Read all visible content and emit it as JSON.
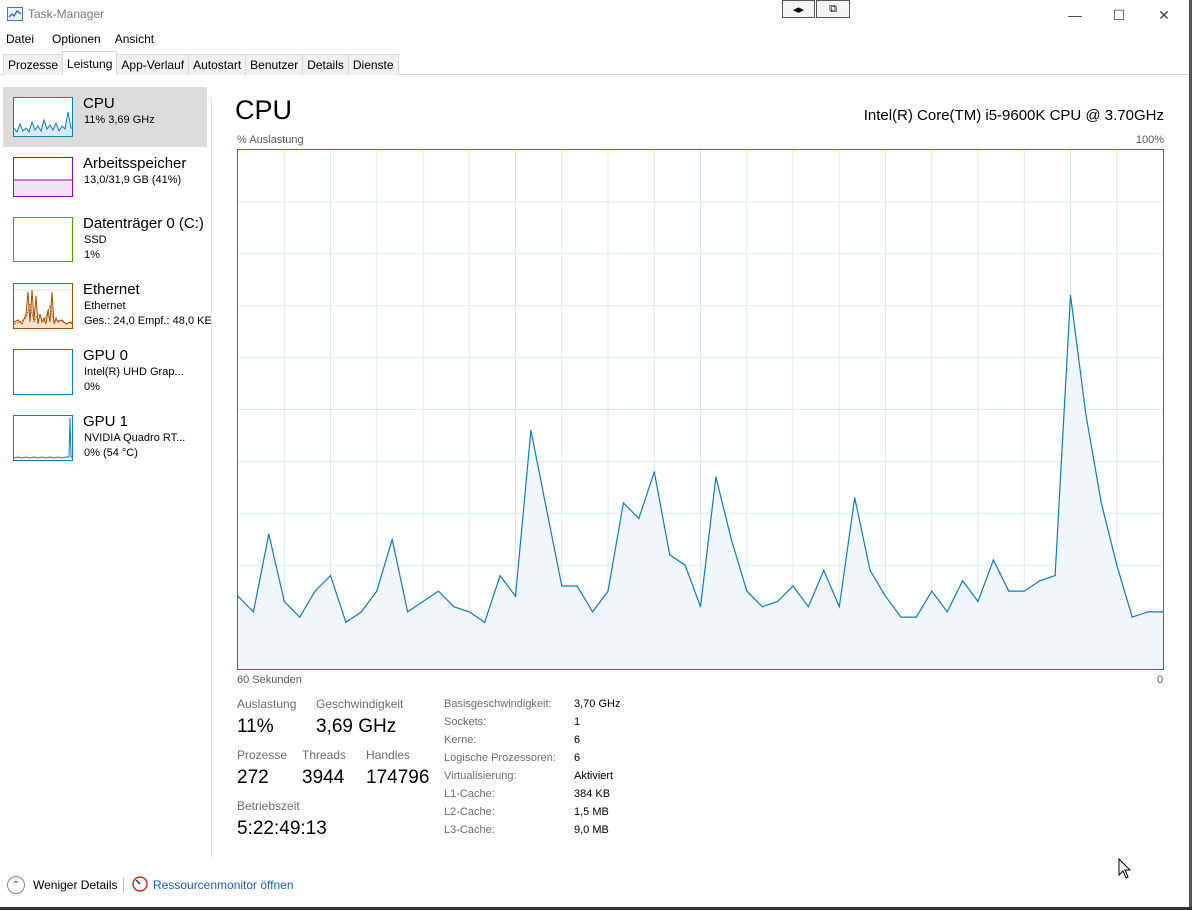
{
  "window": {
    "title": "Task-Manager"
  },
  "menu": [
    "Datei",
    "Optionen",
    "Ansicht"
  ],
  "tabs": [
    "Prozesse",
    "Leistung",
    "App-Verlauf",
    "Autostart",
    "Benutzer",
    "Details",
    "Dienste"
  ],
  "sidebar": {
    "items": [
      {
        "name": "CPU",
        "lines": [
          "11%  3,69 GHz"
        ],
        "color": "#117dbb"
      },
      {
        "name": "Arbeitsspeicher",
        "lines": [
          "13,0/31,9 GB (41%)"
        ],
        "color": "#8b12ae"
      },
      {
        "name": "Datenträger 0 (C:)",
        "lines": [
          "SSD",
          "1%"
        ],
        "color": "#4da60c"
      },
      {
        "name": "Ethernet",
        "lines": [
          "Ethernet",
          "Ges.: 24,0  Empf.: 48,0 KE"
        ],
        "color": "#a74f01"
      },
      {
        "name": "GPU 0",
        "lines": [
          "Intel(R) UHD Grap...",
          "0%"
        ],
        "color": "#117dbb"
      },
      {
        "name": "GPU 1",
        "lines": [
          "NVIDIA Quadro RT...",
          "0%  (54 °C)"
        ],
        "color": "#117dbb"
      }
    ]
  },
  "main": {
    "title": "CPU",
    "model": "Intel(R) Core(TM) i5-9600K CPU @ 3.70GHz",
    "y_label": "% Auslastung",
    "y_max_label": "100%",
    "x_left_label": "60 Sekunden",
    "x_right_label": "0"
  },
  "chart_data": {
    "type": "area",
    "title": "CPU",
    "ylabel": "% Auslastung",
    "xlabel": "60 Sekunden",
    "ylim": [
      0,
      100
    ],
    "xlim": [
      60,
      0
    ],
    "grid": true,
    "color": "#117dbb",
    "fill": "#f1f6fa",
    "x": [
      60,
      59,
      58,
      57,
      56,
      55,
      54,
      53,
      52,
      51,
      50,
      49,
      48,
      47,
      46,
      45,
      44,
      43,
      42,
      41,
      40,
      39,
      38,
      37,
      36,
      35,
      34,
      33,
      32,
      31,
      30,
      29,
      28,
      27,
      26,
      25,
      24,
      23,
      22,
      21,
      20,
      19,
      18,
      17,
      16,
      15,
      14,
      13,
      12,
      11,
      10,
      9,
      8,
      7,
      6,
      5,
      4,
      3,
      2,
      1,
      0
    ],
    "values": [
      14,
      11,
      26,
      13,
      10,
      15,
      18,
      9,
      11,
      15,
      25,
      11,
      13,
      15,
      12,
      11,
      9,
      18,
      14,
      46,
      31,
      16,
      16,
      11,
      15,
      32,
      29,
      38,
      22,
      20,
      12,
      37,
      25,
      15,
      12,
      13,
      16,
      12,
      19,
      12,
      33,
      19,
      14,
      10,
      10,
      15,
      11,
      17,
      13,
      21,
      15,
      15,
      17,
      18,
      72,
      49,
      32,
      20,
      10,
      11,
      11
    ]
  },
  "stats": {
    "auslastung_label": "Auslastung",
    "auslastung": "11%",
    "geschwindigkeit_label": "Geschwindigkeit",
    "geschwindigkeit": "3,69 GHz",
    "prozesse_label": "Prozesse",
    "prozesse": "272",
    "threads_label": "Threads",
    "threads": "3944",
    "handles_label": "Handles",
    "handles": "174796",
    "betriebszeit_label": "Betriebszeit",
    "betriebszeit": "5:22:49:13"
  },
  "info": [
    {
      "label": "Basisgeschwindigkeit:",
      "value": "3,70 GHz"
    },
    {
      "label": "Sockets:",
      "value": "1"
    },
    {
      "label": "Kerne:",
      "value": "6"
    },
    {
      "label": "Logische Prozessoren:",
      "value": "6"
    },
    {
      "label": "Virtualisierung:",
      "value": "Aktiviert"
    },
    {
      "label": "L1-Cache:",
      "value": "384 KB"
    },
    {
      "label": "L2-Cache:",
      "value": "1,5 MB"
    },
    {
      "label": "L3-Cache:",
      "value": "9,0 MB"
    }
  ],
  "footer": {
    "less_details": "Weniger Details",
    "resource_monitor": "Ressourcenmonitor öffnen"
  },
  "icons": {
    "app": "task-manager-icon",
    "snap_left": "◂▸",
    "snap_right": "⧉",
    "minimize": "—",
    "maximize": "☐",
    "close": "✕",
    "less": "⌃"
  }
}
